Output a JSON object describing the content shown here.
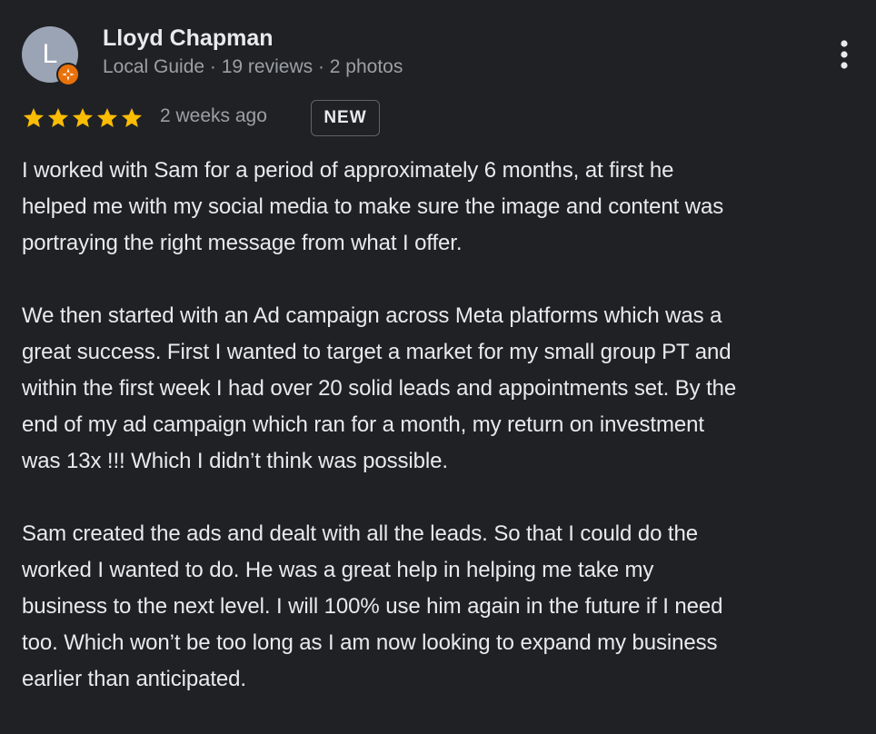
{
  "reviewer": {
    "initial": "L",
    "name": "Lloyd Chapman",
    "meta": "Local Guide · 19 reviews · 2 photos",
    "avatar_color": "#9aa4b4",
    "badge_color": "#e8710a",
    "badge_icon": "local-guide-star-icon"
  },
  "menu_icon": "more-vert-icon",
  "rating": {
    "stars": 5,
    "max": 5,
    "star_color": "#fbbc04"
  },
  "date": "2 weeks ago",
  "badge": "NEW",
  "review": {
    "paragraphs": [
      {
        "lines": [
          "I worked with Sam for a period of approximately 6 months, at first he",
          "helped me with my social media to make sure the image and content was",
          "portraying the right message from what I offer."
        ]
      },
      {
        "lines": [
          "We then started with an Ad campaign across Meta platforms which was a",
          "great success. First I wanted to target a market for my small group PT and",
          "within the first week I had over 20 solid leads and appointments set. By the",
          "end of my ad campaign which ran for a month, my return on investment",
          "was 13x !!! Which I didn’t think was possible."
        ]
      },
      {
        "lines": [
          "Sam created the ads and dealt with all the leads. So that I could do the",
          "worked I wanted to do. He was a great help in helping me take my",
          "business to the next level. I will 100% use him again in the future if I need",
          "too. Which won’t be too long as I am now looking to expand my business",
          "earlier than anticipated."
        ]
      }
    ]
  }
}
